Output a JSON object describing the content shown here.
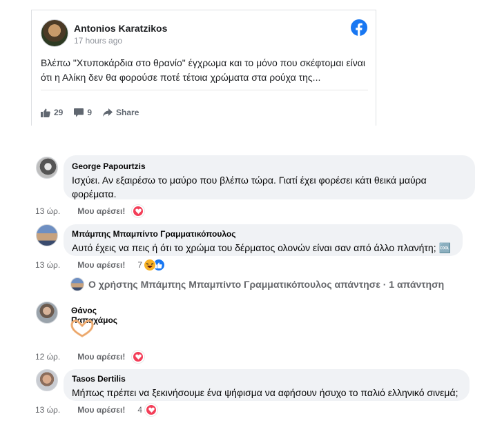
{
  "post": {
    "author": "Antonios Karatzikos",
    "time": "17 hours ago",
    "text": "Βλέπω \"Χτυποκάρδια στο θρανίο\" έγχρωμα και το μόνο που σκέφτομαι είναι ότι η Αλίκη δεν θα φορούσε ποτέ τέτοια χρώματα στα ρούχα της...",
    "likes": "29",
    "comments": "9",
    "share_label": "Share",
    "brand_color": "#1877f2"
  },
  "comments": [
    {
      "author": "George Papourtzis",
      "text": "Ισχύει. Αν εξαιρέσω το μαύρο που βλέπω τώρα. Γιατί έχει φορέσει κάτι θεικά μαύρα φορέματα.",
      "time": "13 ώρ.",
      "like_label": "Μου αρέσει!",
      "reaction": "love"
    },
    {
      "author": "Μπάμπης Μπαμπίντο Γραμματικόπουλος",
      "text": "Αυτό έχεις να πεις ή ότι το χρώμα του δέρματος ολονών είναι σαν από άλλο πλανήτη; 🆒",
      "time": "13 ώρ.",
      "like_label": "Μου αρέσει!",
      "reaction_count": "7",
      "reaction": "haha-like",
      "reply_summary": "Ο χρήστης Μπάμπης Μπαμπίντο Γραμματικόπουλος απάντησε · 1 απάντηση"
    },
    {
      "author": "Θάνος Παπαχάμος",
      "text": "🫶",
      "time": "12 ώρ.",
      "like_label": "Μου αρέσει!",
      "reaction": "love"
    },
    {
      "author": "Tasos Dertilis",
      "text": "Μήπως πρέπει να ξεκινήσουμε ένα ψήφισμα να αφήσουν ήσυχο το παλιό ελληνικό σινεμά;",
      "time": "13 ώρ.",
      "like_label": "Μου αρέσει!",
      "reaction_count": "4"
    }
  ]
}
